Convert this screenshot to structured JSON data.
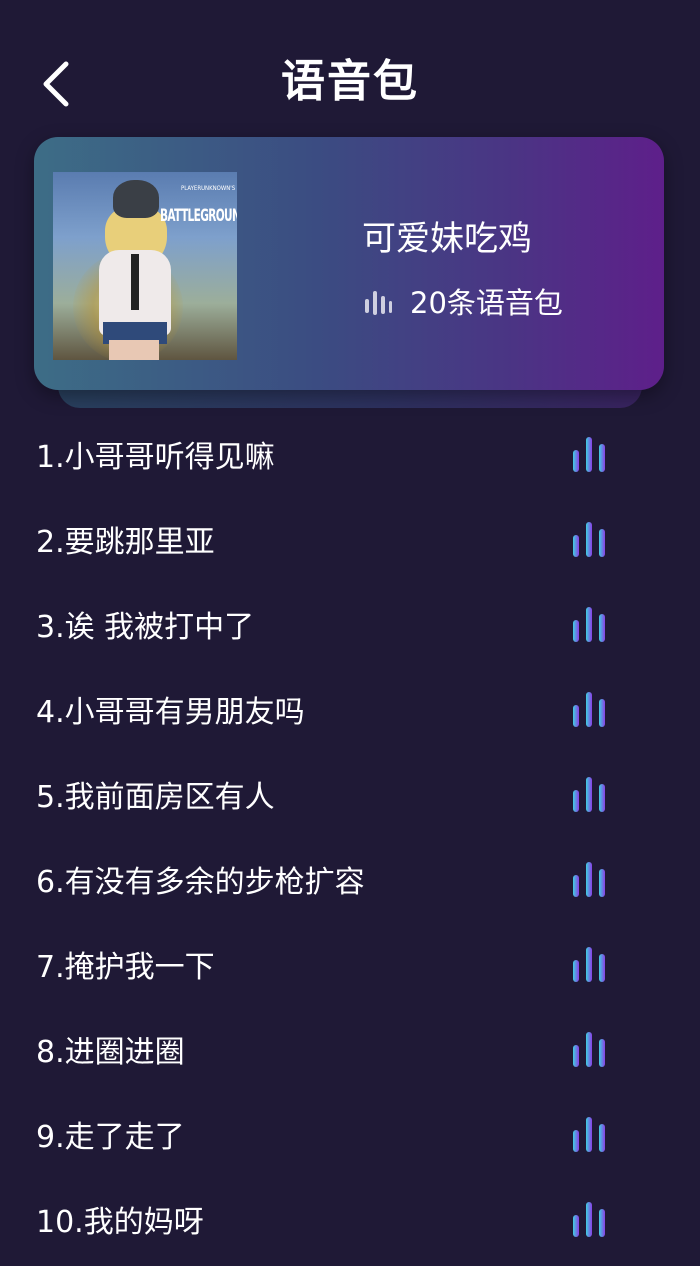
{
  "header": {
    "title": "语音包"
  },
  "pack": {
    "name": "可爱妹吃鸡",
    "count_label": "20条语音包",
    "cover_logo": "BATTLEGROUNDS",
    "cover_logo_small": "PLAYERUNKNOWN'S"
  },
  "items": [
    {
      "label": "1.小哥哥听得见嘛"
    },
    {
      "label": "2.要跳那里亚"
    },
    {
      "label": "3.诶 我被打中了"
    },
    {
      "label": "4.小哥哥有男朋友吗"
    },
    {
      "label": "5.我前面房区有人"
    },
    {
      "label": "6.有没有多余的步枪扩容"
    },
    {
      "label": "7.掩护我一下"
    },
    {
      "label": "8.进圈进圈"
    },
    {
      "label": "9.走了走了"
    },
    {
      "label": "10.我的妈呀"
    }
  ],
  "colors": {
    "background": "#1f1936",
    "bar_teal": "#3fd0e0",
    "bar_purple": "#8a3fe6"
  },
  "icons": {
    "back": "chevron-left-icon",
    "count": "sound-bars-icon",
    "play": "sound-wave-icon"
  }
}
